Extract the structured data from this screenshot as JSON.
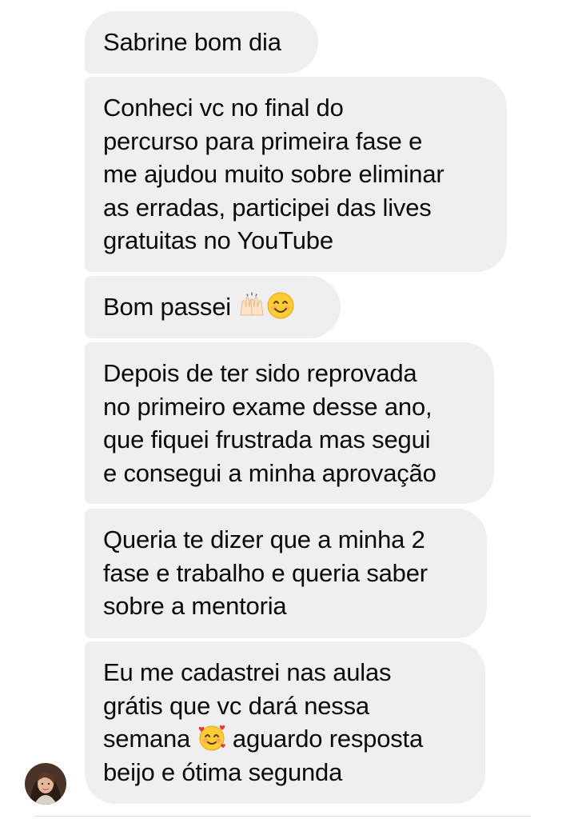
{
  "conversation": {
    "messages": [
      {
        "text": "Sabrine bom dia"
      },
      {
        "text": "Conheci vc no final do\npercurso para primeira fase e\nme ajudou muito sobre eliminar\nas erradas, participei das lives\ngratuitas no YouTube"
      },
      {
        "text_before": "Bom passei ",
        "emojis": [
          "raising-hands-emoji",
          "smiling-face-emoji"
        ]
      },
      {
        "text": "Depois de ter sido reprovada\nno primeiro exame desse ano,\nque fiquei frustrada mas segui\ne consegui a minha aprovação"
      },
      {
        "text": "Queria te dizer que a minha 2\nfase e trabalho e queria saber\nsobre a mentoria"
      },
      {
        "text_before": "Eu me cadastrei nas aulas\ngrátis que vc dará nessa\nsemana ",
        "emoji": "smiling-face-with-hearts-emoji",
        "text_after": " aguardo resposta\nbeijo e ótima segunda"
      }
    ]
  },
  "colors": {
    "bubble_background": "#efeff0",
    "text": "#0b0b0b",
    "page_background": "#ffffff"
  }
}
